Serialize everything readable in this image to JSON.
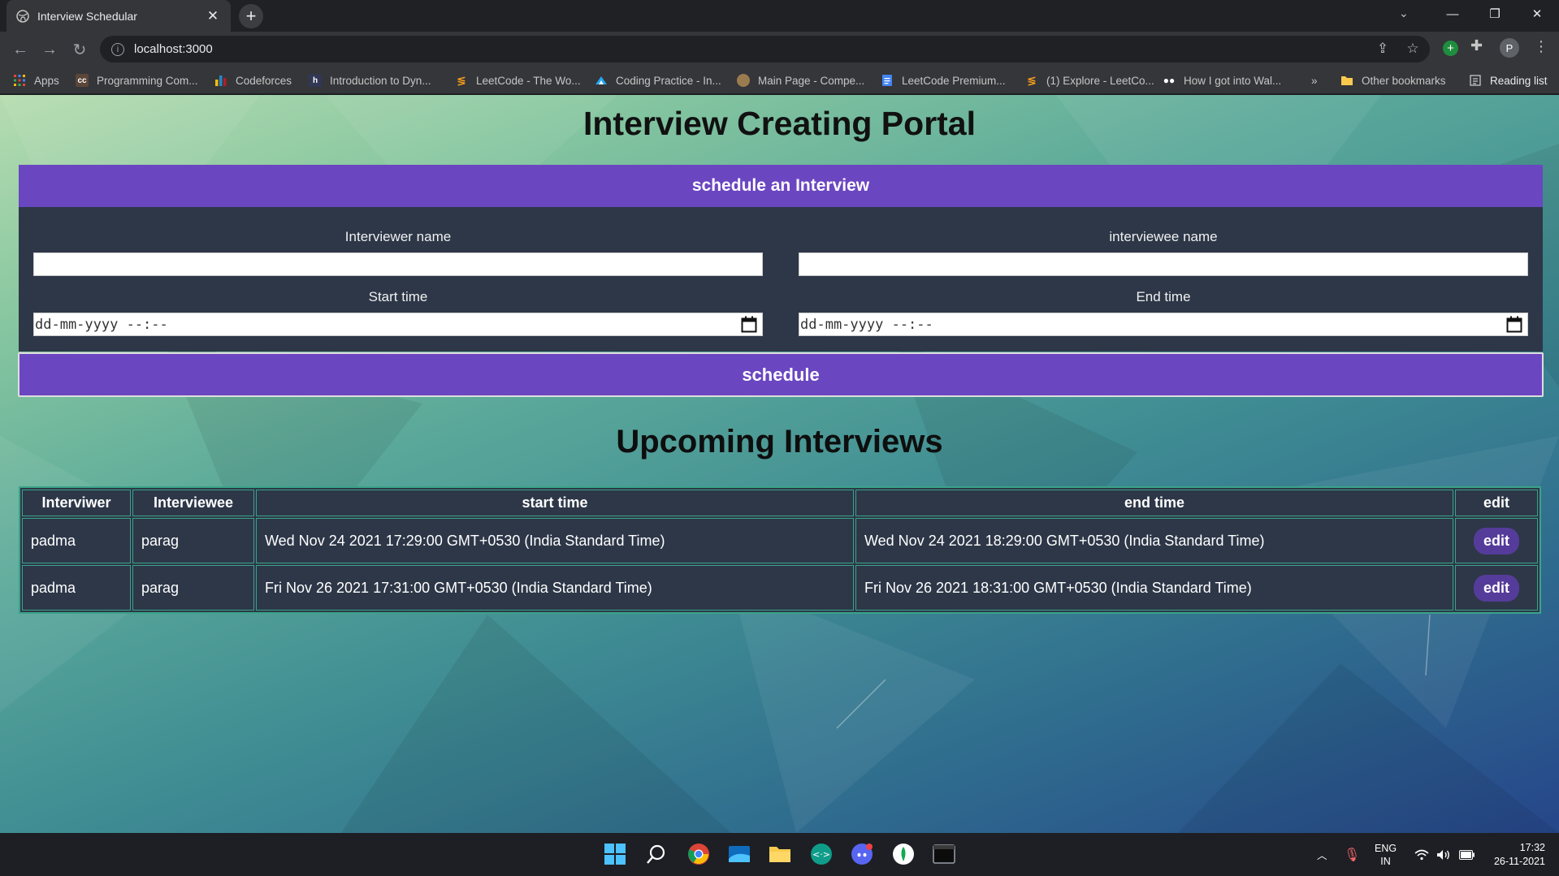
{
  "browser": {
    "tab_title": "Interview Schedular",
    "address": "localhost:3000",
    "bookmarks": [
      {
        "label": "Apps",
        "icon": "apps-grid-icon",
        "color": "#ea4335"
      },
      {
        "label": "Programming Com...",
        "icon": "codechef-icon",
        "color": "#5b4638"
      },
      {
        "label": "Codeforces",
        "icon": "codeforces-icon",
        "color": "#1f8acb"
      },
      {
        "label": "Introduction to Dyn...",
        "icon": "hackerearth-icon",
        "color": "#323754"
      },
      {
        "label": "LeetCode - The Wo...",
        "icon": "leetcode-icon",
        "color": "#f89f1b"
      },
      {
        "label": "Coding Practice - In...",
        "icon": "interviewbit-icon",
        "color": "#22a7f0"
      },
      {
        "label": "Main Page - Compe...",
        "icon": "cp-algorithms-icon",
        "color": "#9a7b4f"
      },
      {
        "label": "LeetCode Premium...",
        "icon": "google-docs-icon",
        "color": "#4285f4"
      },
      {
        "label": "(1) Explore - LeetCo...",
        "icon": "leetcode-icon",
        "color": "#f89f1b"
      },
      {
        "label": "How I got into Wal...",
        "icon": "medium-icon",
        "color": "#ffffff"
      }
    ],
    "more_bookmarks": "»",
    "other_bookmarks": "Other bookmarks",
    "reading_list": "Reading list"
  },
  "page": {
    "title": "Interview Creating Portal",
    "form": {
      "header": "schedule an Interview",
      "interviewer_label": "Interviewer name",
      "interviewer_value": "",
      "interviewee_label": "interviewee name",
      "interviewee_value": "",
      "start_label": "Start time",
      "start_placeholder": "dd-mm-yyyy --:--",
      "end_label": "End time",
      "end_placeholder": "dd-mm-yyyy --:--",
      "submit_label": "schedule"
    },
    "upcoming_title": "Upcoming Interviews",
    "table": {
      "headers": [
        "Interviwer",
        "Interviewee",
        "start time",
        "end time",
        "edit"
      ],
      "rows": [
        {
          "interviewer": "padma",
          "interviewee": "parag",
          "start": "Wed Nov 24 2021 17:29:00 GMT+0530 (India Standard Time)",
          "end": "Wed Nov 24 2021 18:29:00 GMT+0530 (India Standard Time)",
          "edit": "edit"
        },
        {
          "interviewer": "padma",
          "interviewee": "parag",
          "start": "Fri Nov 26 2021 17:31:00 GMT+0530 (India Standard Time)",
          "end": "Fri Nov 26 2021 18:31:00 GMT+0530 (India Standard Time)",
          "edit": "edit"
        }
      ]
    }
  },
  "taskbar": {
    "apps": [
      "windows-start-icon",
      "search-icon",
      "chrome-icon",
      "mail-icon",
      "file-explorer-icon",
      "remote-desktop-icon",
      "discord-icon",
      "mongodb-compass-icon",
      "terminal-icon"
    ],
    "lang_line1": "ENG",
    "lang_line2": "IN",
    "time": "17:32",
    "date": "26-11-2021"
  },
  "colors": {
    "accent": "#6b46c1",
    "panel": "#2d3748",
    "table_border": "#3aa389",
    "edit_button": "#553c9a"
  }
}
